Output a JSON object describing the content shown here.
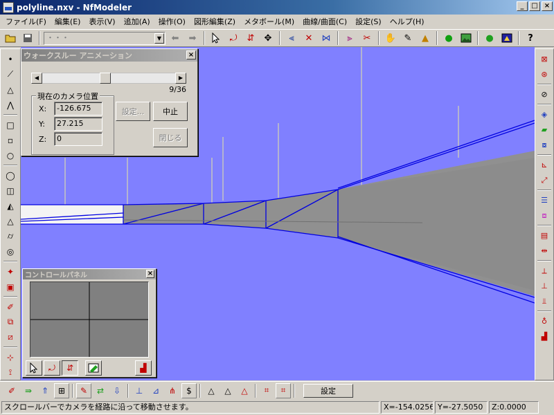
{
  "window": {
    "title": "polyline.nxv - NfModeler"
  },
  "window_buttons": {
    "minimize": "_",
    "maximize": "□",
    "close": "×"
  },
  "menu": [
    {
      "label": "ファイル(F)",
      "name": "menu-file"
    },
    {
      "label": "編集(E)",
      "name": "menu-edit"
    },
    {
      "label": "表示(V)",
      "name": "menu-view"
    },
    {
      "label": "追加(A)",
      "name": "menu-add"
    },
    {
      "label": "操作(O)",
      "name": "menu-operate"
    },
    {
      "label": "図形編集(Z)",
      "name": "menu-shape-edit"
    },
    {
      "label": "メタボール(M)",
      "name": "menu-metaball"
    },
    {
      "label": "曲線/曲面(C)",
      "name": "menu-curve-surface"
    },
    {
      "label": "設定(S)",
      "name": "menu-settings"
    },
    {
      "label": "ヘルプ(H)",
      "name": "menu-help"
    }
  ],
  "toolbar": {
    "combo_value": "・・・",
    "icons": {
      "open": "folder-open-icon",
      "save": "save-icon",
      "back": "arrow-left-icon",
      "forward": "arrow-right-icon",
      "select": "cursor-icon",
      "rotate": "rotate-icon",
      "move": "move-icon",
      "help": "help-icon"
    }
  },
  "walkthrough": {
    "title": "ウォークスルー アニメーション",
    "frame_counter": "9/36",
    "frame_current": 9,
    "frame_total": 36,
    "group_label": "現在のカメラ位置",
    "x_label": "X:",
    "x_value": "-126.675",
    "y_label": "Y:",
    "y_value": "27.215",
    "z_label": "Z:",
    "z_value": "0",
    "settings_button": "設定...",
    "stop_button": "中止",
    "close_button": "閉じる"
  },
  "control_panel": {
    "title": "コントロールパネル"
  },
  "bottom_toolbar": {
    "settings_label": "設定"
  },
  "status": {
    "message": "スクロールバーでカメラを経路に沿って移動させます。",
    "x": "X=-154.0256",
    "y": "Y=-27.5050",
    "z": "Z:0.0000"
  },
  "colors": {
    "viewport_bg": "#8080ff",
    "surface_gray": "#909090",
    "edge_blue": "#0000e0",
    "marker_yellow": "#e8e8a0"
  }
}
